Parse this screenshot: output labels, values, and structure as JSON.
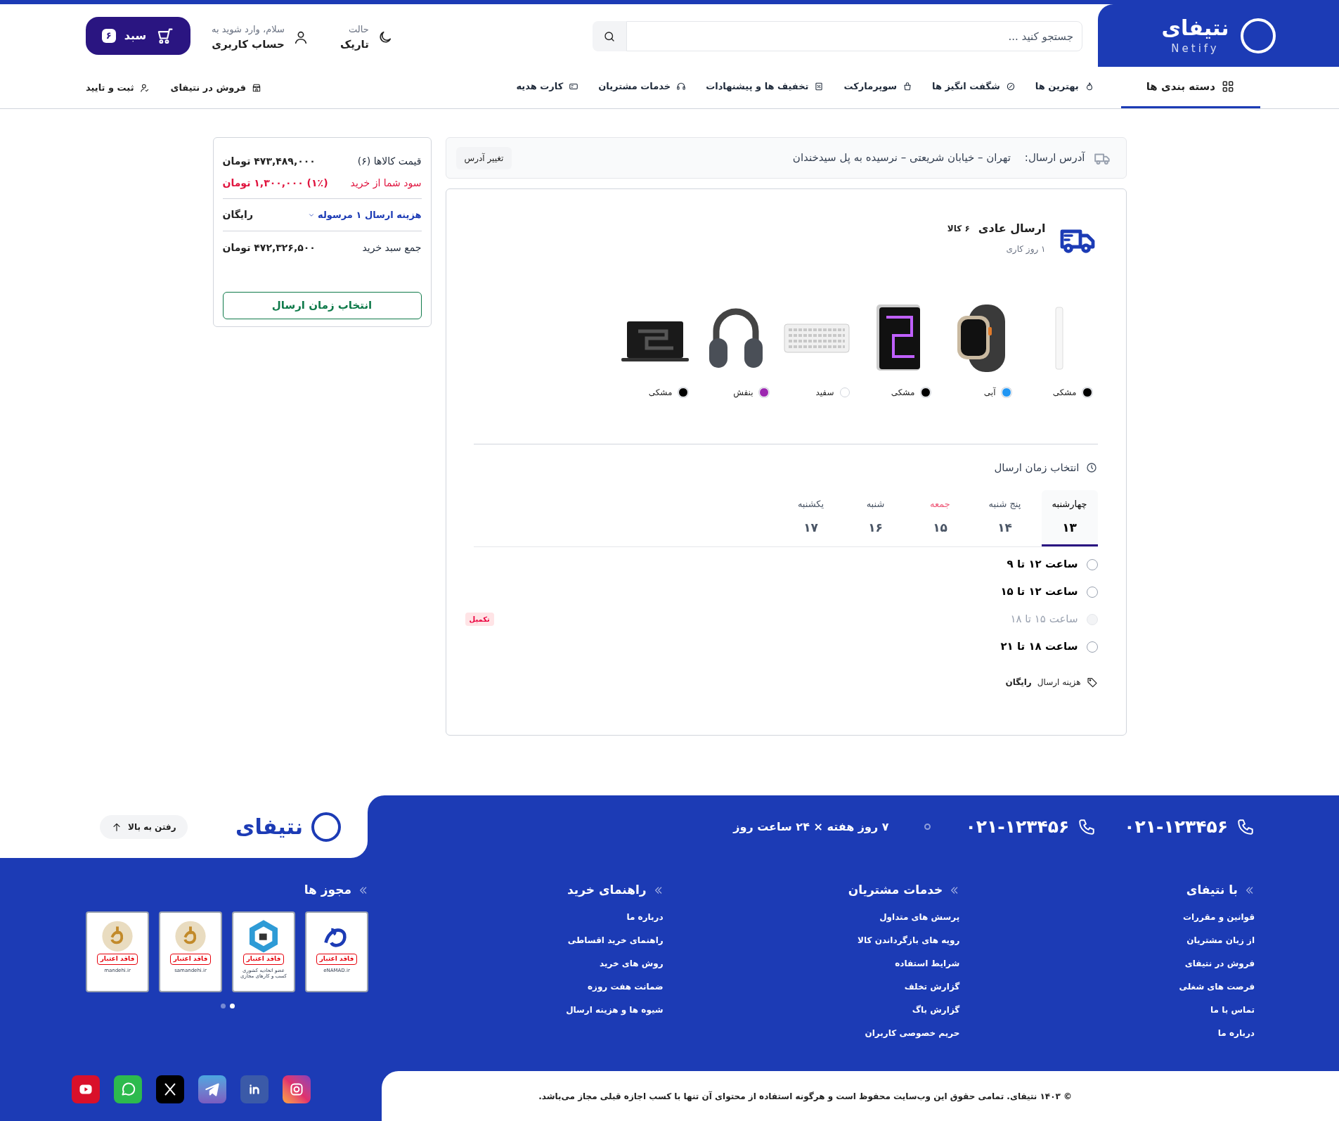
{
  "header": {
    "logo": {
      "name": "نتیفای",
      "latin": "Netify"
    },
    "search": {
      "placeholder": "جستجو کنید ..."
    },
    "theme": {
      "label": "حالت",
      "value": "تاریک"
    },
    "account": {
      "greeting": "سلام، وارد شوید به",
      "label": "حساب کاربری"
    },
    "cart": {
      "label": "سبد",
      "count": "۶"
    }
  },
  "nav": {
    "items": [
      {
        "label": "دسته بندی ها",
        "selected": true
      },
      {
        "label": "بهترین ها",
        "selected": false
      },
      {
        "label": "شگفت انگیز ها",
        "selected": false
      },
      {
        "label": "سوپرمارکت",
        "selected": false
      },
      {
        "label": "تخفیف ها و پیشنهادات",
        "selected": false
      },
      {
        "label": "خدمات مشتریان",
        "selected": false
      },
      {
        "label": "کارت هدیه",
        "selected": false
      }
    ],
    "links": [
      {
        "label": "فروش در نتیفای"
      },
      {
        "label": "ثبت و تایید"
      }
    ]
  },
  "address": {
    "label": "آدرس ارسال:",
    "value": "تهران – خیابان شریعتی – نرسیده به پل سیدخندان",
    "button": "تغییر آدرس"
  },
  "shipment": {
    "title": "ارسال عادی",
    "count": "۶ کالا",
    "duration": "۱ روز کاری",
    "products": [
      {
        "color_name": "مشکی",
        "color": "#000000"
      },
      {
        "color_name": "آبی",
        "color": "#2196f3"
      },
      {
        "color_name": "مشکی",
        "color": "#000000"
      },
      {
        "color_name": "سفید",
        "color": "#ffffff"
      },
      {
        "color_name": "بنفش",
        "color": "#9c27b0"
      },
      {
        "color_name": "مشکی",
        "color": "#000000"
      }
    ],
    "schedule": {
      "title": "انتخاب زمان ارسال",
      "days": [
        {
          "weekday": "چهارشنبه",
          "date": "۱۳",
          "selected": true,
          "holiday": false
        },
        {
          "weekday": "پنج شنبه",
          "date": "۱۴",
          "selected": false,
          "holiday": false
        },
        {
          "weekday": "جمعه",
          "date": "۱۵",
          "selected": false,
          "holiday": true
        },
        {
          "weekday": "شنبه",
          "date": "۱۶",
          "selected": false,
          "holiday": false
        },
        {
          "weekday": "یکشنبه",
          "date": "۱۷",
          "selected": false,
          "holiday": false
        }
      ],
      "slots": [
        {
          "label": "ساعت ۱۲ تا ۹",
          "selected": false,
          "disabled": false
        },
        {
          "label": "ساعت ۱۲ تا ۱۵",
          "selected": false,
          "disabled": false
        },
        {
          "label": "ساعت ۱۵ تا ۱۸",
          "selected": false,
          "disabled": true,
          "badge": "تکمیل"
        },
        {
          "label": "ساعت ۱۸ تا ۲۱",
          "selected": false,
          "disabled": false
        }
      ],
      "cost": {
        "label": "هزینه ارسال",
        "value": "رایگان"
      }
    }
  },
  "summary": {
    "rows": [
      {
        "kind": "price",
        "label": "قیمت کالاها (۶)",
        "value": "۴۷۳,۴۸۹,۰۰۰ تومان"
      },
      {
        "kind": "profit",
        "label": "سود شما از خرید",
        "value": "(۱٪) ۱,۳۰۰,۰۰۰ تومان"
      },
      {
        "kind": "shipping",
        "label": "هزینه ارسال ۱ مرسوله",
        "value": "رایگان"
      },
      {
        "kind": "total",
        "label": "جمع سبد خرید",
        "value": "۴۷۲,۳۲۶,۵۰۰ تومان"
      }
    ],
    "button": "انتخاب زمان ارسال"
  },
  "footer": {
    "phones": [
      "۰۲۱-۱۲۳۴۵۶",
      "۰۲۱-۱۲۳۴۵۶"
    ],
    "hours": "۷ روز هفته × ۲۴ ساعت روز",
    "logo": "نتیفای",
    "back_to_top": "رفتن به بالا",
    "columns": [
      {
        "title": "با نتیفای",
        "links": [
          "قوانین و مقررات",
          "از زبان مشتریان",
          "فروش در نتیفای",
          "فرصت های شغلی",
          "تماس با ما",
          "درباره ما"
        ]
      },
      {
        "title": "خدمات مشتریان",
        "links": [
          "پرسش های متداول",
          "رویه های بازگرداندن کالا",
          "شرایط استفاده",
          "گزارش تخلف",
          "گزارش باگ",
          "حریم خصوصی کاربران"
        ]
      },
      {
        "title": "راهنمای خرید",
        "links": [
          "درباره ما",
          "راهنمای خرید اقساطی",
          "روش های خرید",
          "ضمانت هفت روزه",
          "شیوه ها و هزینه ارسال"
        ]
      }
    ],
    "licenses": {
      "title": "مجوز ها",
      "badges": [
        {
          "label": "فاقد اعتبار",
          "caption": "eNAMAD.ir"
        },
        {
          "label": "فاقد اعتبار",
          "caption": "عضو اتحادیه کشوری کسب و کارهای مجازی"
        },
        {
          "label": "فاقد اعتبار",
          "caption": "samandehi.ir"
        },
        {
          "label": "فاقد اعتبار",
          "caption": "mandehi.ir"
        }
      ],
      "dots": [
        {
          "selected": true
        },
        {
          "selected": false
        }
      ]
    },
    "copyright": "© ۱۴۰۳ نتیفای. تمامی حقوق این وب‌سایت محفوظ است و هرگونه استفاده از محتوای آن تنها با کسب اجازه قبلی مجاز می‌باشد."
  }
}
